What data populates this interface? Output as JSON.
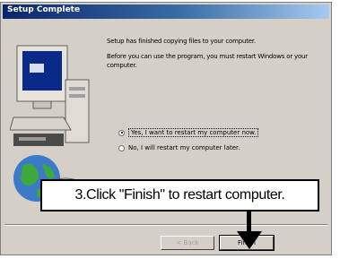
{
  "window": {
    "title": "Setup Complete"
  },
  "messages": {
    "line1": "Setup has finished copying files to your computer.",
    "line2": "Before you can use the program, you must restart Windows or your computer."
  },
  "options": [
    {
      "label": "Yes, I want to restart my computer now.",
      "selected": true
    },
    {
      "label": "No, I will restart my computer later.",
      "selected": false
    }
  ],
  "buttons": {
    "back": "< Back",
    "finish": "Finish"
  },
  "callout": {
    "text": "3.Click \"Finish\" to restart computer."
  }
}
